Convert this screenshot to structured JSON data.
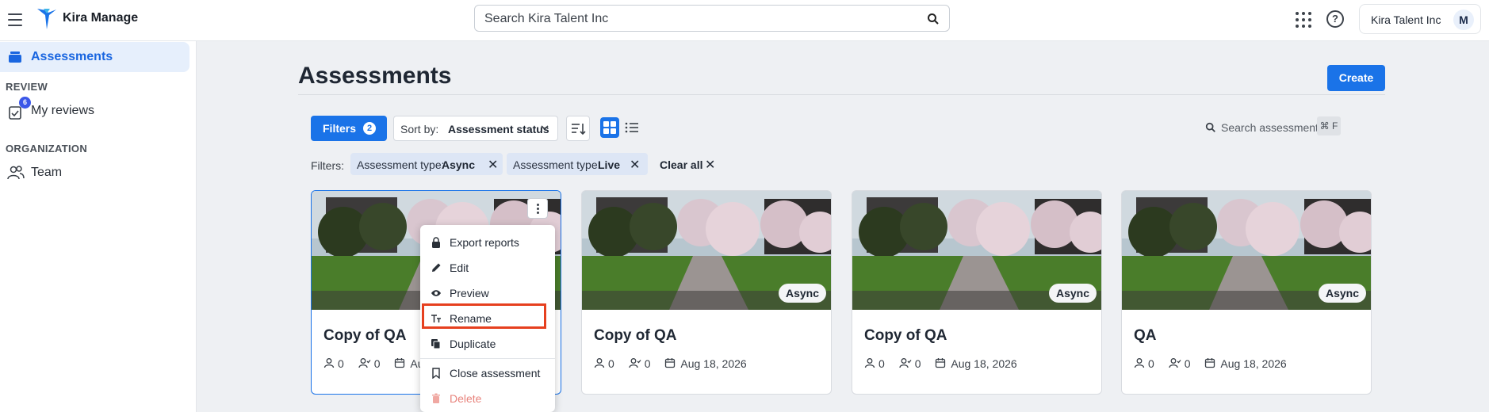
{
  "app": {
    "name": "Kira Manage",
    "org": "Kira Talent Inc",
    "avatar_initial": "M",
    "accent": "#1a73e8"
  },
  "search": {
    "placeholder": "Search Kira Talent Inc"
  },
  "sidebar": {
    "active_item": "Assessments",
    "sections": [
      {
        "label": "REVIEW",
        "items": [
          {
            "label": "My reviews",
            "badge": "6"
          }
        ]
      },
      {
        "label": "ORGANIZATION",
        "items": [
          {
            "label": "Team"
          }
        ]
      }
    ]
  },
  "page": {
    "title": "Assessments",
    "create_label": "Create"
  },
  "toolbar": {
    "filters_label": "Filters",
    "filters_count": "2",
    "sort_prefix": "Sort by:",
    "sort_value": "Assessment status",
    "search_placeholder": "Search assessments",
    "shortcut": "⌘ F"
  },
  "active_filters": {
    "label": "Filters:",
    "chips": [
      {
        "key": "Assessment type:",
        "value": "Async"
      },
      {
        "key": "Assessment type:",
        "value": "Live"
      }
    ],
    "clear_all": "Clear all"
  },
  "cards": [
    {
      "title": "Copy of QA",
      "reviewers": "0",
      "applicants": "0",
      "date": "Aug 18, 2026",
      "date_visible": "Au",
      "type": "Async"
    },
    {
      "title": "Copy of QA",
      "reviewers": "0",
      "applicants": "0",
      "date": "Aug 18, 2026",
      "type": "Async"
    },
    {
      "title": "Copy of QA",
      "reviewers": "0",
      "applicants": "0",
      "date": "Aug 18, 2026",
      "type": "Async"
    },
    {
      "title": "QA",
      "reviewers": "0",
      "applicants": "0",
      "date": "Aug 18, 2026",
      "type": "Async"
    }
  ],
  "context_menu": {
    "items": [
      {
        "label": "Export reports",
        "icon": "lock-icon"
      },
      {
        "label": "Edit",
        "icon": "pencil-icon"
      },
      {
        "label": "Preview",
        "icon": "eye-icon"
      },
      {
        "label": "Rename",
        "icon": "text-format-icon",
        "highlighted": true
      },
      {
        "label": "Duplicate",
        "icon": "copy-icon"
      },
      {
        "label": "Close assessment",
        "icon": "bookmark-icon"
      },
      {
        "label": "Delete",
        "icon": "trash-icon",
        "danger": true
      }
    ]
  }
}
